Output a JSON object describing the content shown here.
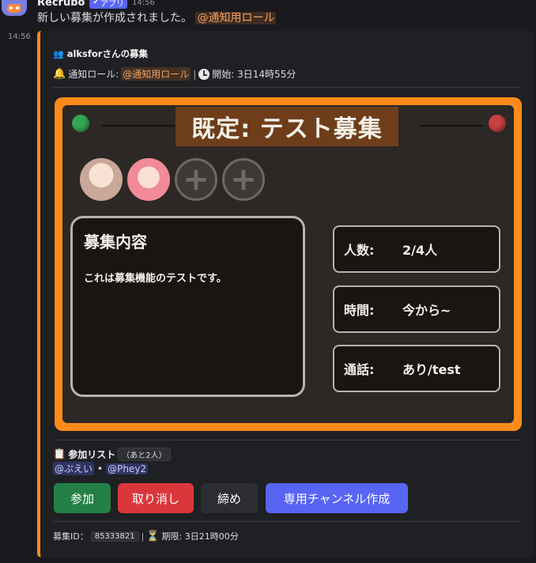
{
  "message": {
    "author": "Recrubo",
    "badge": "アプリ",
    "time": "14:56",
    "side_time": "14:56",
    "text": "新しい募集が作成されました。",
    "mention": "@通知用ロール"
  },
  "embed": {
    "accent_color": "#ff8a1c",
    "author": "alksforさんの募集",
    "notify_label": "通知ロール:",
    "notify_role": "@通知用ロール",
    "separator": "|",
    "start_label": "開始: 3日14時55分",
    "card": {
      "title": "既定: テスト募集",
      "content_title": "募集内容",
      "content_body": "これは募集機能のテストです。",
      "info": [
        {
          "label": "人数:",
          "value": "2/4人"
        },
        {
          "label": "時間:",
          "value": "今から~"
        },
        {
          "label": "通話:",
          "value": "あり/test"
        }
      ],
      "slots_filled": 2,
      "slots_total": 4
    },
    "participants": {
      "label": "参加リスト",
      "remaining": "（あと2人）",
      "members": [
        "@ぷえい",
        "@Phey2"
      ],
      "member_sep": "•"
    },
    "buttons": {
      "join": "参加",
      "cancel": "取り消し",
      "close": "締め",
      "channel": "専用チャンネル作成"
    },
    "footer": {
      "id_label": "募集ID：",
      "id_value": "85333821",
      "separator": "|",
      "deadline": "期限: 3日21時00分"
    }
  }
}
